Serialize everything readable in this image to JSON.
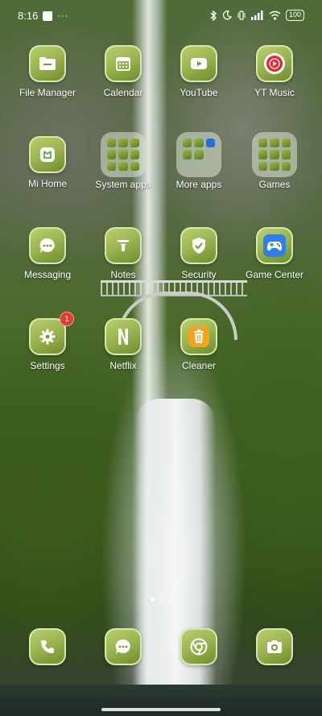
{
  "status_bar": {
    "time": "8:16",
    "overflow": "···",
    "battery": "100",
    "icons": [
      "bluetooth-icon",
      "moon-icon",
      "vibrate-icon",
      "signal-icon",
      "wifi-icon"
    ]
  },
  "apps": [
    {
      "label": "File Manager",
      "icon": "folder-icon"
    },
    {
      "label": "Calendar",
      "icon": "calendar-icon"
    },
    {
      "label": "YouTube",
      "icon": "play-icon"
    },
    {
      "label": "YT Music",
      "icon": "music-icon"
    },
    {
      "label": "Mi Home",
      "icon": "home-icon"
    },
    {
      "label": "System apps",
      "icon": "folder"
    },
    {
      "label": "More apps",
      "icon": "folder"
    },
    {
      "label": "Games",
      "icon": "folder"
    },
    {
      "label": "Messaging",
      "icon": "chat-icon"
    },
    {
      "label": "Notes",
      "icon": "funnel-icon"
    },
    {
      "label": "Security",
      "icon": "shield-icon"
    },
    {
      "label": "Game Center",
      "icon": "gamepad-icon"
    },
    {
      "label": "Settings",
      "icon": "gear-icon",
      "badge": "1"
    },
    {
      "label": "Netflix",
      "icon": "netflix-icon"
    },
    {
      "label": "Cleaner",
      "icon": "trash-icon"
    }
  ],
  "dock": [
    {
      "icon": "phone-icon"
    },
    {
      "icon": "chat-icon"
    },
    {
      "icon": "chrome-icon"
    },
    {
      "icon": "camera-icon"
    }
  ],
  "pager": {
    "pages": 3,
    "active": 1
  },
  "colors": {
    "icon_gradient_light": "#b9cf6c",
    "icon_gradient_dark": "#6f8e2c",
    "badge": "#e23a2f"
  }
}
